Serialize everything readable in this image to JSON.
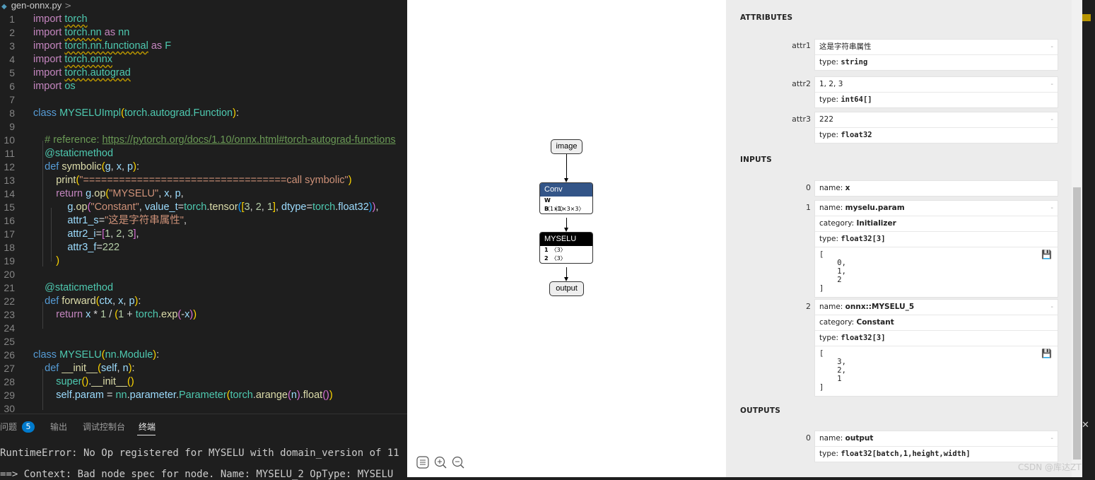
{
  "editor": {
    "filename": "gen-onnx.py",
    "breadcrumb_sep": ">",
    "lines": [
      {
        "n": "1",
        "html": "<span class='kw'>import</span> <span class='cls sq'>torch</span>"
      },
      {
        "n": "2",
        "html": "<span class='kw'>import</span> <span class='cls sq'>torch.nn</span> <span class='kw'>as</span> <span class='cls'>nn</span>"
      },
      {
        "n": "3",
        "html": "<span class='kw'>import</span> <span class='cls sq'>torch.nn.functional</span> <span class='kw'>as</span> <span class='cls'>F</span>"
      },
      {
        "n": "4",
        "html": "<span class='kw'>import</span> <span class='cls sq'>torch.onnx</span>"
      },
      {
        "n": "5",
        "html": "<span class='kw'>import</span> <span class='cls sq'>torch.autograd</span>"
      },
      {
        "n": "6",
        "html": "<span class='kw'>import</span> <span class='cls'>os</span>"
      },
      {
        "n": "7",
        "html": ""
      },
      {
        "n": "8",
        "html": "<span class='kwb'>class</span> <span class='cls'>MYSELUImpl</span><span class='br1'>(</span><span class='cls'>torch.autograd.Function</span><span class='br1'>)</span>:"
      },
      {
        "n": "9",
        "html": ""
      },
      {
        "n": "10",
        "html": "    <span class='cm'># reference: <span class='link'>https://pytorch.org/docs/1.10/onnx.html#torch-autograd-functions</span></span>"
      },
      {
        "n": "11",
        "html": "    <span class='dec'>@staticmethod</span>"
      },
      {
        "n": "12",
        "html": "    <span class='kwb'>def</span> <span class='fn'>symbolic</span><span class='br1'>(</span><span class='prm'>g</span>, <span class='prm'>x</span>, <span class='prm'>p</span><span class='br1'>)</span>:"
      },
      {
        "n": "13",
        "html": "        <span class='fn'>print</span><span class='br1'>(</span><span class='str'>\"==================================call symbolic\"</span><span class='br1'>)</span>"
      },
      {
        "n": "14",
        "html": "        <span class='kw'>return</span> <span class='var'>g</span>.<span class='fn'>op</span><span class='br1'>(</span><span class='str'>\"MYSELU\"</span>, <span class='var'>x</span>, <span class='var'>p</span>,"
      },
      {
        "n": "15",
        "html": "            <span class='var'>g</span>.<span class='fn'>op</span><span class='br2'>(</span><span class='str'>\"Constant\"</span>, <span class='var'>value_t</span>=<span class='cls'>torch</span>.<span class='fn'>tensor</span><span class='br3'>(</span><span class='br1'>[</span><span class='num'>3</span>, <span class='num'>2</span>, <span class='num'>1</span><span class='br1'>]</span>, <span class='var'>dtype</span>=<span class='cls'>torch</span>.<span class='var'>float32</span><span class='br3'>)</span><span class='br2'>)</span>,"
      },
      {
        "n": "16",
        "html": "            <span class='var'>attr1_s</span>=<span class='str'>\"这是字符串属性\"</span>,"
      },
      {
        "n": "17",
        "html": "            <span class='var'>attr2_i</span>=<span class='br2'>[</span><span class='num'>1</span>, <span class='num'>2</span>, <span class='num'>3</span><span class='br2'>]</span>,"
      },
      {
        "n": "18",
        "html": "            <span class='var'>attr3_f</span>=<span class='num'>222</span>"
      },
      {
        "n": "19",
        "html": "        <span class='br1'>)</span>"
      },
      {
        "n": "20",
        "html": ""
      },
      {
        "n": "21",
        "html": "    <span class='dec'>@staticmethod</span>"
      },
      {
        "n": "22",
        "html": "    <span class='kwb'>def</span> <span class='fn'>forward</span><span class='br1'>(</span><span class='prm'>ctx</span>, <span class='prm'>x</span>, <span class='prm'>p</span><span class='br1'>)</span>:"
      },
      {
        "n": "23",
        "html": "        <span class='kw'>return</span> <span class='var'>x</span> * <span class='num'>1</span> / <span class='br1'>(</span><span class='num'>1</span> + <span class='cls'>torch</span>.<span class='fn'>exp</span><span class='br2'>(</span>-<span class='var'>x</span><span class='br2'>)</span><span class='br1'>)</span>"
      },
      {
        "n": "24",
        "html": ""
      },
      {
        "n": "25",
        "html": ""
      },
      {
        "n": "26",
        "html": "<span class='kwb'>class</span> <span class='cls'>MYSELU</span><span class='br1'>(</span><span class='cls'>nn.Module</span><span class='br1'>)</span>:"
      },
      {
        "n": "27",
        "html": "    <span class='kwb'>def</span> <span class='fn'>__init__</span><span class='br1'>(</span><span class='prm'>self</span>, <span class='prm'>n</span><span class='br1'>)</span>:"
      },
      {
        "n": "28",
        "html": "        <span class='cls'>super</span><span class='br1'>()</span>.<span class='fn'>__init__</span><span class='br1'>()</span>"
      },
      {
        "n": "29",
        "html": "        <span class='var'>self</span>.<span class='var'>param</span> = <span class='cls'>nn</span>.<span class='var'>parameter</span>.<span class='cls'>Parameter</span><span class='br1'>(</span><span class='cls'>torch</span>.<span class='fn'>arange</span><span class='br2'>(</span><span class='var'>n</span><span class='br2'>)</span>.<span class='fn'>float</span><span class='br2'>()</span><span class='br1'>)</span>"
      },
      {
        "n": "30",
        "html": ""
      }
    ]
  },
  "panel": {
    "tabs": [
      "问题",
      "输出",
      "调试控制台",
      "终端"
    ],
    "problem_count": "5",
    "terminal_lines": [
      "RuntimeError: No Op registered for MYSELU with domain_version of 11",
      "==> Context: Bad node spec for node. Name: MYSELU_2 OpType: MYSELU"
    ]
  },
  "graph": {
    "input_node": "image",
    "conv": {
      "title": "Conv",
      "color": "#335588",
      "rows": [
        {
          "k": "W",
          "v": "〈1×1×3×3〉"
        },
        {
          "k": "B",
          "v": "〈1〉"
        }
      ]
    },
    "myselu": {
      "title": "MYSELU",
      "color": "#000000",
      "rows": [
        {
          "k": "1",
          "v": "〈3〉"
        },
        {
          "k": "2",
          "v": "〈3〉"
        }
      ]
    },
    "output_node": "output",
    "toolbar_icons": [
      "menu-icon",
      "zoom-in-icon",
      "zoom-out-icon"
    ]
  },
  "sidebar": {
    "attributes_title": "ATTRIBUTES",
    "attributes": [
      {
        "name": "attr1",
        "value": "这是字符串属性",
        "type_label": "type: ",
        "type": "string"
      },
      {
        "name": "attr2",
        "value": "1, 2, 3",
        "type_label": "type: ",
        "type": "int64[]"
      },
      {
        "name": "attr3",
        "value": "222",
        "type_label": "type: ",
        "type": "float32"
      }
    ],
    "inputs_title": "INPUTS",
    "inputs": [
      {
        "index": "0",
        "name_label": "name: ",
        "name": "x"
      },
      {
        "index": "1",
        "name_label": "name: ",
        "name": "myselu.param",
        "category_label": "category: ",
        "category": "Initializer",
        "type_label": "type: ",
        "type": "float32[3]",
        "tensor": "[\n    0,\n    1,\n    2\n]"
      },
      {
        "index": "2",
        "name_label": "name: ",
        "name": "onnx::MYSELU_5",
        "category_label": "category: ",
        "category": "Constant",
        "type_label": "type: ",
        "type": "float32[3]",
        "tensor": "[\n    3,\n    2,\n    1\n]"
      }
    ],
    "outputs_title": "OUTPUTS",
    "outputs": [
      {
        "index": "0",
        "name_label": "name: ",
        "name": "output",
        "type_label": "type: ",
        "type": "float32[batch,1,height,width]"
      }
    ],
    "expander": "-",
    "save_icon": "💾"
  },
  "watermark": "CSDN @库达ZT"
}
